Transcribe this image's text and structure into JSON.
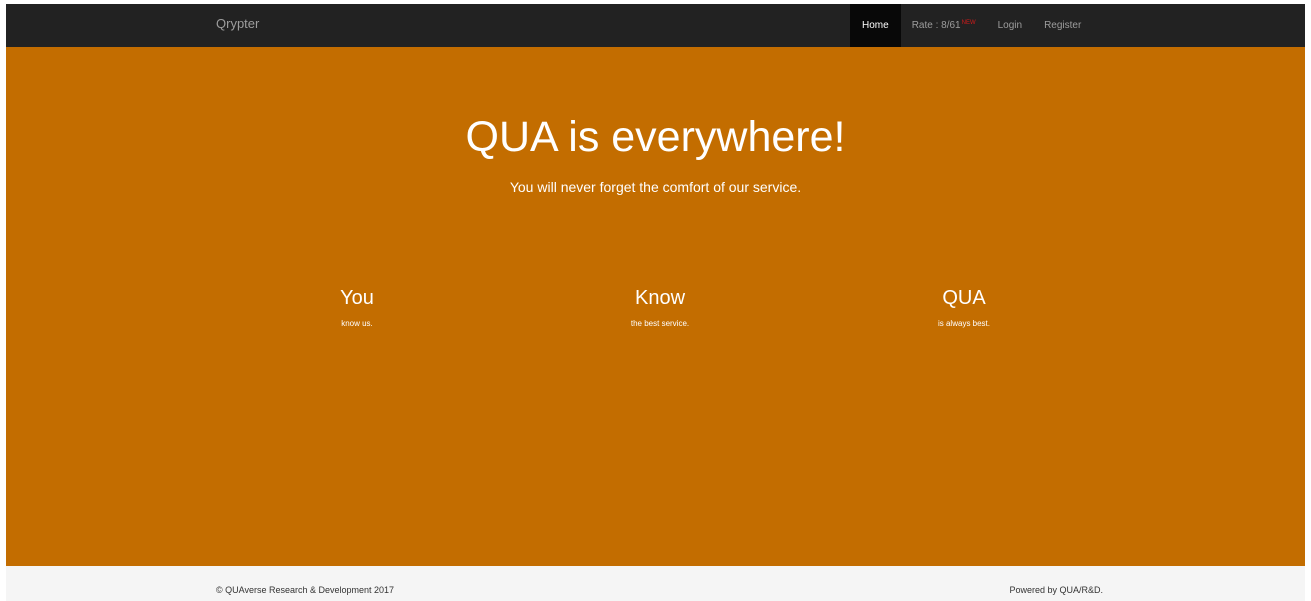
{
  "navbar": {
    "brand": "Qrypter",
    "items": [
      {
        "label": "Home",
        "active": true
      },
      {
        "label": "Rate : 8/61",
        "badge": "NEW"
      },
      {
        "label": "Login"
      },
      {
        "label": "Register"
      }
    ]
  },
  "hero": {
    "title": "QUA is everywhere!",
    "subtitle": "You will never forget the comfort of our service."
  },
  "features": [
    {
      "heading": "You",
      "text": "know us."
    },
    {
      "heading": "Know",
      "text": "the best service."
    },
    {
      "heading": "QUA",
      "text": "is always best."
    }
  ],
  "footer": {
    "copyright": "© QUAverse Research & Development 2017",
    "powered_by": "Powered by QUA/R&D."
  },
  "colors": {
    "navbar_bg": "#222222",
    "hero_bg": "#c36d00",
    "footer_bg": "#f5f5f5",
    "badge": "#d11a1a"
  }
}
